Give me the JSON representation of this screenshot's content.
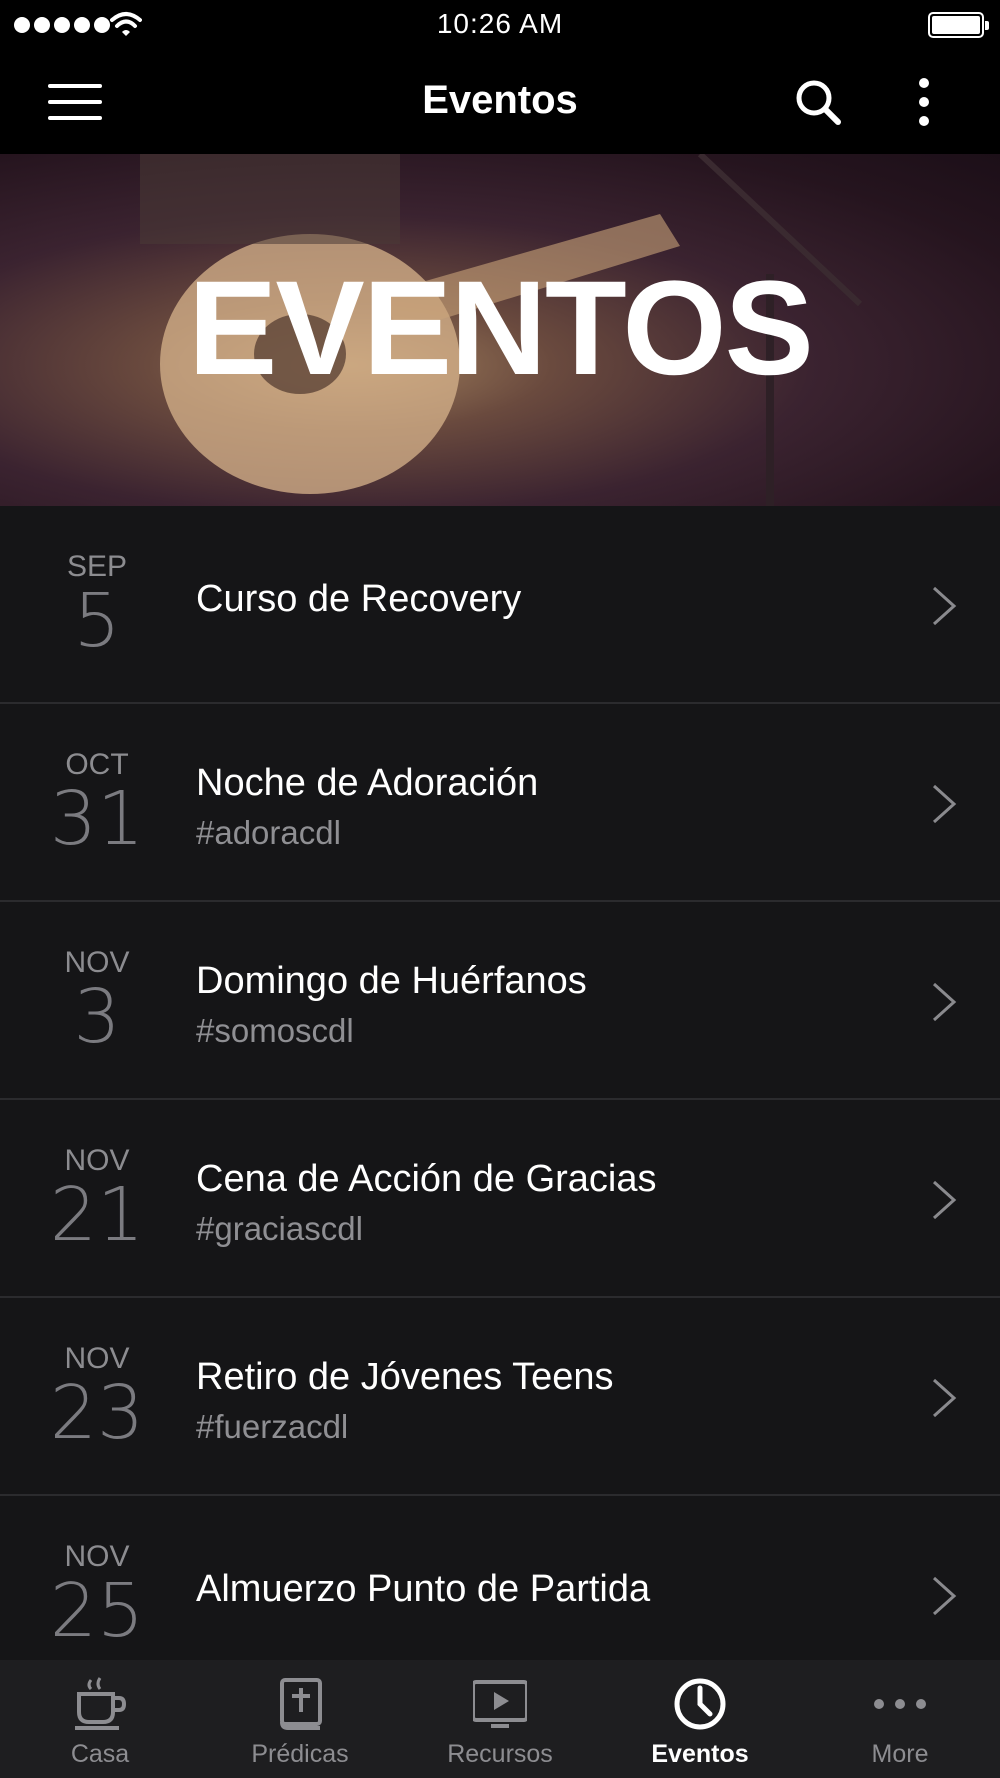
{
  "status_bar": {
    "time": "10:26 AM"
  },
  "nav": {
    "title": "Eventos"
  },
  "hero": {
    "text": "EVENTOS"
  },
  "events": [
    {
      "month": "SEP",
      "day": "5",
      "title": "Curso de Recovery",
      "tag": ""
    },
    {
      "month": "OCT",
      "day": "31",
      "title": "Noche de Adoración",
      "tag": "#adoracdl"
    },
    {
      "month": "NOV",
      "day": "3",
      "title": "Domingo de Huérfanos",
      "tag": "#somoscdl"
    },
    {
      "month": "NOV",
      "day": "21",
      "title": "Cena de Acción de Gracias",
      "tag": "#graciascdl"
    },
    {
      "month": "NOV",
      "day": "23",
      "title": "Retiro de Jóvenes Teens",
      "tag": "#fuerzacdl"
    },
    {
      "month": "NOV",
      "day": "25",
      "title": "Almuerzo Punto de Partida",
      "tag": ""
    }
  ],
  "tabs": [
    {
      "label": "Casa",
      "icon": "coffee-cup-icon",
      "active": false
    },
    {
      "label": "Prédicas",
      "icon": "bible-icon",
      "active": false
    },
    {
      "label": "Recursos",
      "icon": "play-screen-icon",
      "active": false
    },
    {
      "label": "Eventos",
      "icon": "clock-icon",
      "active": true
    },
    {
      "label": "More",
      "icon": "more-dots-icon",
      "active": false
    }
  ],
  "colors": {
    "background": "#000000",
    "list_background": "#151517",
    "tab_bar": "#1e1e20",
    "active_tab": "#ffffff",
    "inactive_tab": "#8d8d91"
  }
}
